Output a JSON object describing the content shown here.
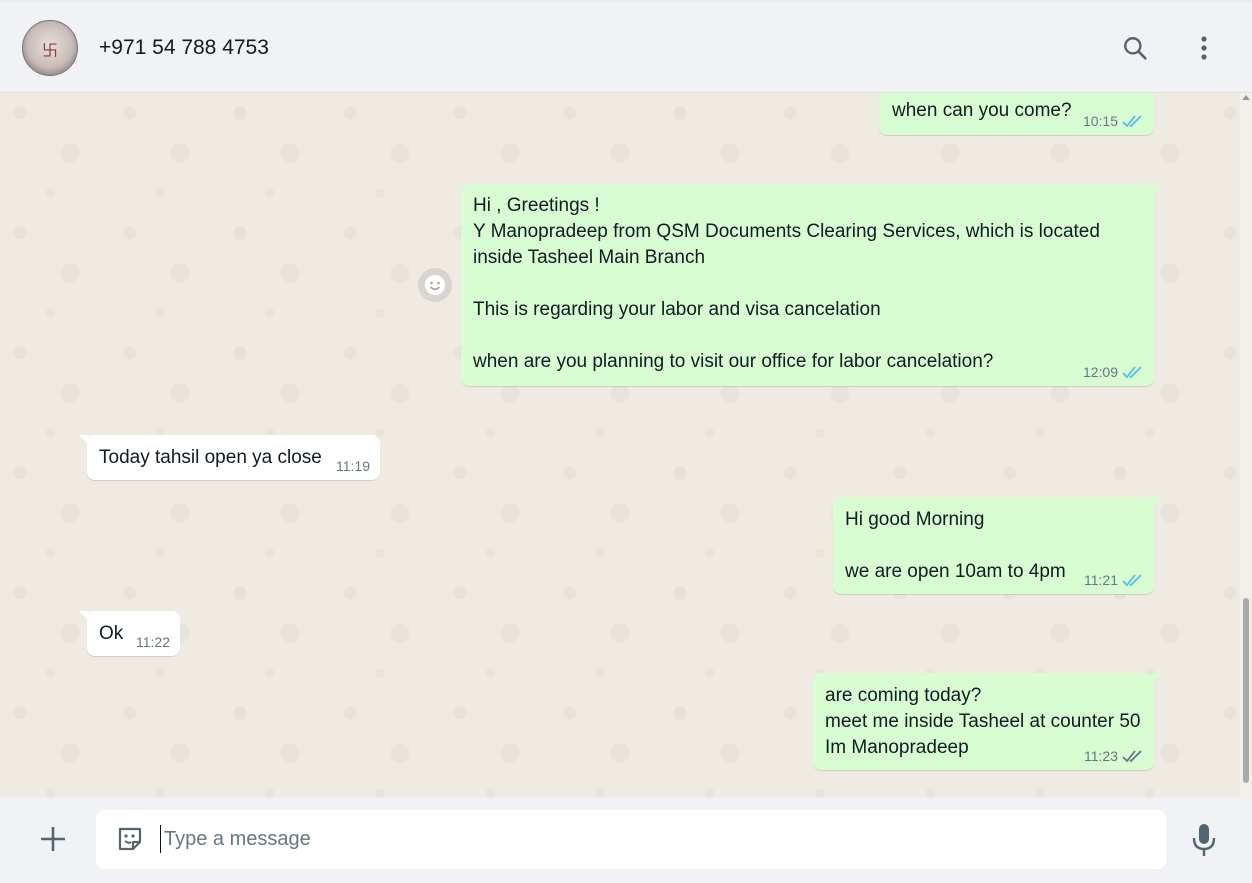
{
  "header": {
    "contact_name": "+971 54 788 4753"
  },
  "messages": [
    {
      "direction": "outgoing",
      "text": "when can you come?",
      "time": "10:15",
      "status": "read"
    },
    {
      "direction": "outgoing",
      "text": "Hi , Greetings !\nY Manopradeep  from QSM Documents Clearing Services, which is located\ninside Tasheel Main Branch\n\nThis is regarding your labor and visa cancelation\n\nwhen are you planning to visit our office for labor cancelation?",
      "time": "12:09",
      "status": "read"
    },
    {
      "direction": "incoming",
      "text": "Today tahsil open ya close",
      "time": "11:19"
    },
    {
      "direction": "outgoing",
      "text": "Hi good Morning\n\nwe are open 10am to 4pm",
      "time": "11:21",
      "status": "read"
    },
    {
      "direction": "incoming",
      "text": "Ok",
      "time": "11:22"
    },
    {
      "direction": "outgoing",
      "text": "are coming today?\nmeet me inside Tasheel at counter 50\nIm Manopradeep",
      "time": "11:23",
      "status": "delivered"
    }
  ],
  "composer": {
    "placeholder": "Type a message",
    "value": ""
  },
  "icons": {
    "search": "search-icon",
    "menu": "more-vertical-icon",
    "attach": "plus-icon",
    "sticker": "sticker-icon",
    "mic": "microphone-icon",
    "react": "emoji-react-icon"
  },
  "colors": {
    "outgoing_bubble": "#d9fdd3",
    "incoming_bubble": "#ffffff",
    "chat_background": "#efeae2",
    "header_background": "#f0f2f5",
    "read_ticks": "#53bdeb",
    "delivered_ticks": "#667781"
  }
}
